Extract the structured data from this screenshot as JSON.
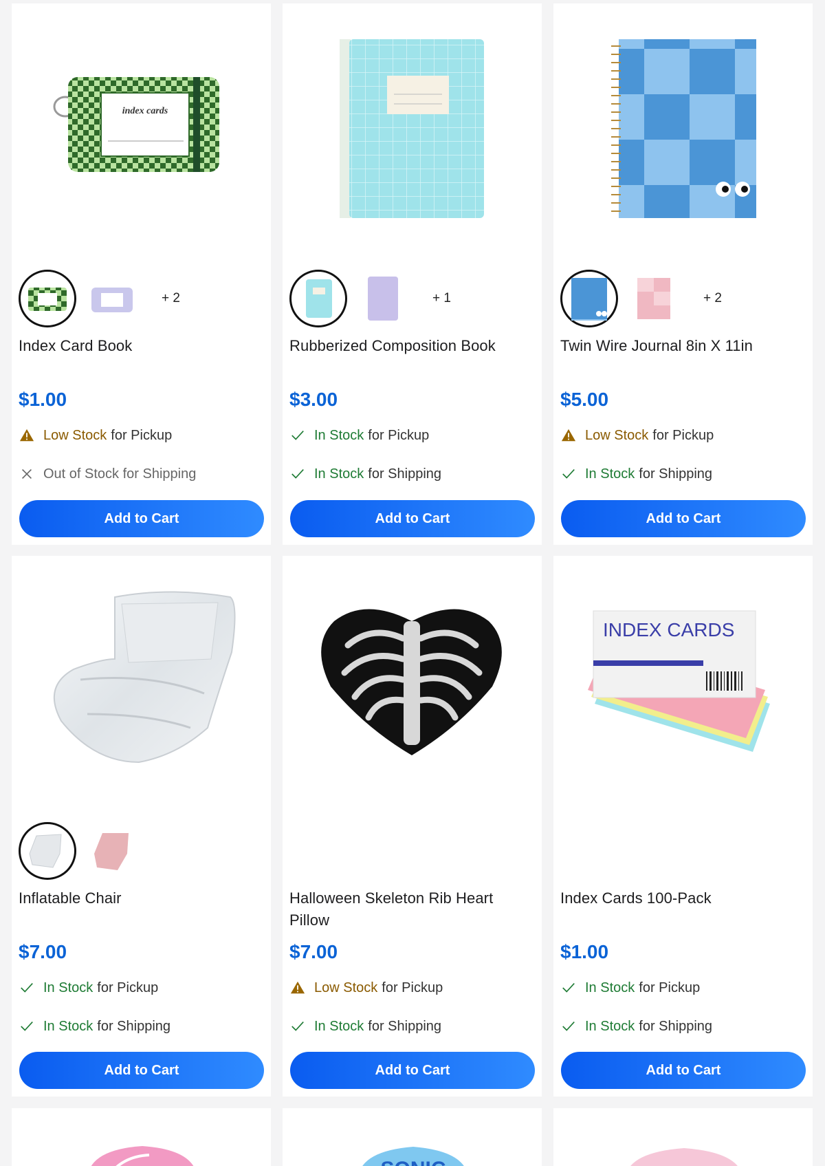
{
  "products": [
    {
      "title": "Index Card Book",
      "price": "$1.00",
      "more": "+ 2",
      "pickup": {
        "status": "Low Stock",
        "rest": "for Pickup",
        "icon": "warning-icon"
      },
      "shipping": {
        "status": "Out of Stock for Shipping",
        "rest": "",
        "icon": "x-icon"
      },
      "button": "Add to Cart",
      "image_label": "index cards"
    },
    {
      "title": "Rubberized Composition Book",
      "price": "$3.00",
      "more": "+ 1",
      "pickup": {
        "status": "In Stock",
        "rest": "for Pickup",
        "icon": "check-icon"
      },
      "shipping": {
        "status": "In Stock",
        "rest": "for Shipping",
        "icon": "check-icon"
      },
      "button": "Add to Cart"
    },
    {
      "title": "Twin Wire Journal 8in X 11in",
      "price": "$5.00",
      "more": "+ 2",
      "pickup": {
        "status": "Low Stock",
        "rest": "for Pickup",
        "icon": "warning-icon"
      },
      "shipping": {
        "status": "In Stock",
        "rest": "for Shipping",
        "icon": "check-icon"
      },
      "button": "Add to Cart"
    },
    {
      "title": "Inflatable Chair",
      "price": "$7.00",
      "more": "",
      "pickup": {
        "status": "In Stock",
        "rest": "for Pickup",
        "icon": "check-icon"
      },
      "shipping": {
        "status": "In Stock",
        "rest": "for Shipping",
        "icon": "check-icon"
      },
      "button": "Add to Cart"
    },
    {
      "title": "Halloween Skeleton Rib Heart Pillow",
      "price": "$7.00",
      "more": "",
      "pickup": {
        "status": "Low Stock",
        "rest": "for Pickup",
        "icon": "warning-icon"
      },
      "shipping": {
        "status": "In Stock",
        "rest": "for Shipping",
        "icon": "check-icon"
      },
      "button": "Add to Cart"
    },
    {
      "title": "Index Cards 100-Pack",
      "price": "$1.00",
      "more": "",
      "pickup": {
        "status": "In Stock",
        "rest": "for Pickup",
        "icon": "check-icon"
      },
      "shipping": {
        "status": "In Stock",
        "rest": "for Shipping",
        "icon": "check-icon"
      },
      "button": "Add to Cart",
      "image_label": "INDEX CARDS"
    }
  ],
  "partial_row_labels": [
    "SONIC"
  ],
  "colors": {
    "price": "#0b63d6",
    "button": "#1a6ff5",
    "in_stock": "#1e7b34",
    "low_stock": "#8a5a00",
    "warning_icon": "#9a6700"
  }
}
